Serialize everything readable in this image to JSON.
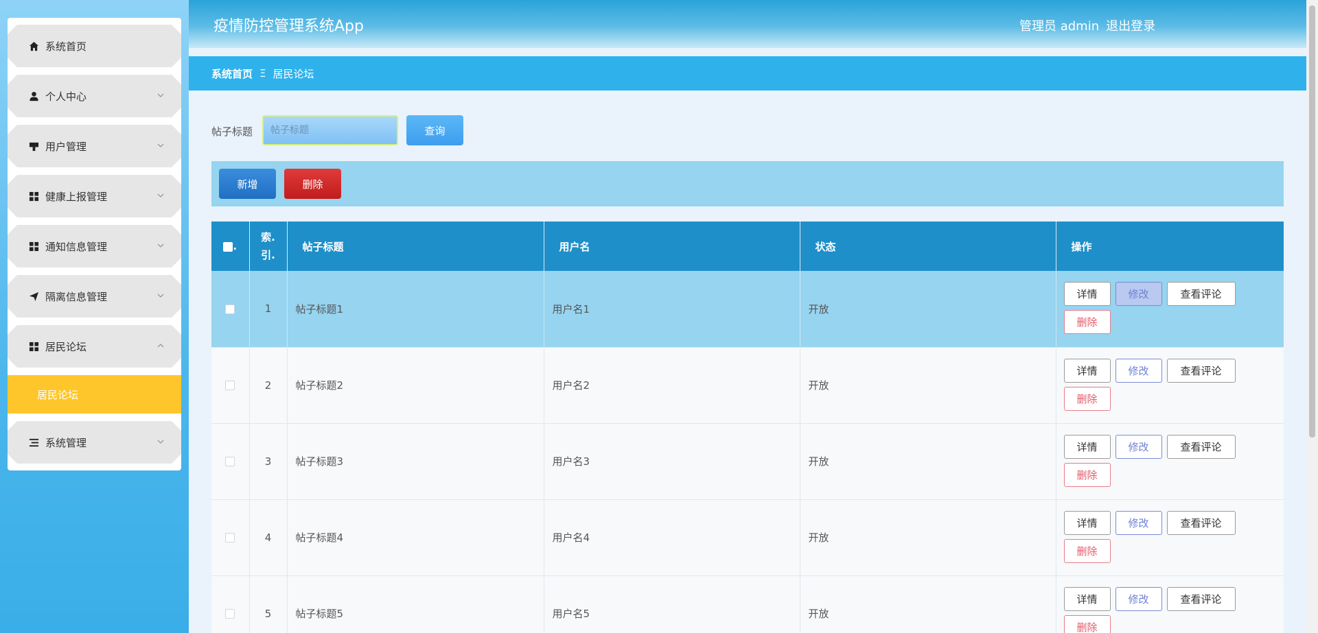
{
  "header": {
    "app_title": "疫情防控管理系统App",
    "user_label": "管理员 admin",
    "logout_label": "退出登录"
  },
  "sidebar": {
    "items": [
      {
        "label": "系统首页",
        "icon": "home-icon"
      },
      {
        "label": "个人中心",
        "icon": "user-icon"
      },
      {
        "label": "用户管理",
        "icon": "flag-icon"
      },
      {
        "label": "健康上报管理",
        "icon": "grid-icon"
      },
      {
        "label": "通知信息管理",
        "icon": "grid-icon"
      },
      {
        "label": "隔离信息管理",
        "icon": "send-icon"
      },
      {
        "label": "居民论坛",
        "icon": "grid-icon",
        "expanded": true
      },
      {
        "label": "系统管理",
        "icon": "list-icon"
      }
    ],
    "submenu_active": "居民论坛"
  },
  "breadcrumb": {
    "home": "系统首页",
    "separator": "Ξ",
    "current": "居民论坛"
  },
  "search": {
    "label": "帖子标题",
    "placeholder": "帖子标题",
    "button": "查询"
  },
  "actions": {
    "add": "新增",
    "delete": "删除"
  },
  "table": {
    "headers": {
      "index_line1": "索.",
      "index_line2": "引.",
      "title": "帖子标题",
      "username": "用户名",
      "status": "状态",
      "ops": "操作"
    },
    "rows": [
      {
        "index": "1",
        "title": "帖子标题1",
        "username": "用户名1",
        "status": "开放"
      },
      {
        "index": "2",
        "title": "帖子标题2",
        "username": "用户名2",
        "status": "开放"
      },
      {
        "index": "3",
        "title": "帖子标题3",
        "username": "用户名3",
        "status": "开放"
      },
      {
        "index": "4",
        "title": "帖子标题4",
        "username": "用户名4",
        "status": "开放"
      },
      {
        "index": "5",
        "title": "帖子标题5",
        "username": "用户名5",
        "status": "开放"
      }
    ],
    "op_labels": {
      "detail": "详情",
      "edit": "修改",
      "comments": "查看评论",
      "delete": "删除"
    }
  },
  "colors": {
    "sidebar_bg": "#4bb6ec",
    "header_bg": "#2aa3d9",
    "breadcrumb_bg": "#2fb2ec",
    "active_submenu": "#ffc62b",
    "table_header": "#1e8fc9",
    "selected_row": "#96d4f0"
  }
}
